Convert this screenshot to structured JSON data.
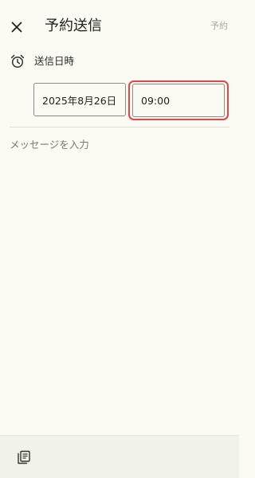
{
  "header": {
    "title": "予約送信",
    "close_icon": "close-icon",
    "schedule_label": "予約"
  },
  "datetime": {
    "icon": "alarm-clock-icon",
    "label": "送信日時",
    "date_value": "2025年8月26日",
    "time_value": "09:00"
  },
  "message": {
    "placeholder": "メッセージを入力"
  },
  "bottom_bar": {
    "templates_icon": "stacked-documents-icon"
  },
  "colors": {
    "background": "#fbfbf3",
    "highlight_outline": "#e2454a",
    "disabled_text": "#a8a8a2",
    "bottom_bar": "#f1f2e8"
  }
}
